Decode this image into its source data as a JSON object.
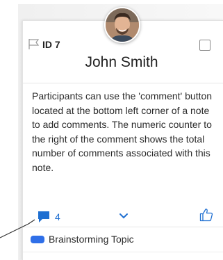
{
  "note": {
    "id_label": "ID 7",
    "author": "John Smith",
    "body": "Participants can use the 'comment' button located at the bottom left corner of a note to add comments. The numeric counter to the right of the comment shows the total number of comments associated with this note.",
    "comment_count": "4",
    "flag_icon": "flag-outline-icon",
    "checkbox_icon": "checkbox-unchecked-icon",
    "comment_icon": "comment-bubble-icon",
    "expand_icon": "chevron-down-icon",
    "like_icon": "thumbs-up-outline-icon",
    "topic": {
      "label": "Brainstorming Topic",
      "color": "#2f6fe8"
    }
  },
  "colors": {
    "accent": "#1f6fd1",
    "text": "#2b2b2b",
    "pointer": "#333333"
  }
}
